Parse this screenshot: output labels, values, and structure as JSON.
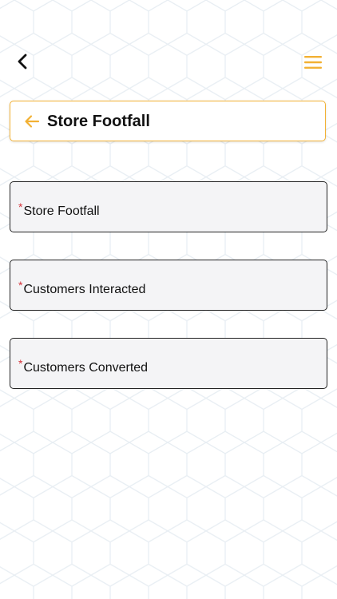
{
  "header": {
    "title": "Store Footfall"
  },
  "form": {
    "required_marker": "*",
    "fields": [
      {
        "label": "Store Footfall",
        "value": ""
      },
      {
        "label": "Customers Interacted",
        "value": ""
      },
      {
        "label": "Customers Converted",
        "value": ""
      }
    ]
  },
  "colors": {
    "accent": "#f2b134",
    "required": "#d6333a",
    "field_border": "#222222",
    "field_background": "#f4f4f6",
    "pattern": "#e8eef3"
  },
  "icons": {
    "top_left": "chevron-left-icon",
    "top_right": "hamburger-menu-icon",
    "header_left": "arrow-left-icon"
  }
}
